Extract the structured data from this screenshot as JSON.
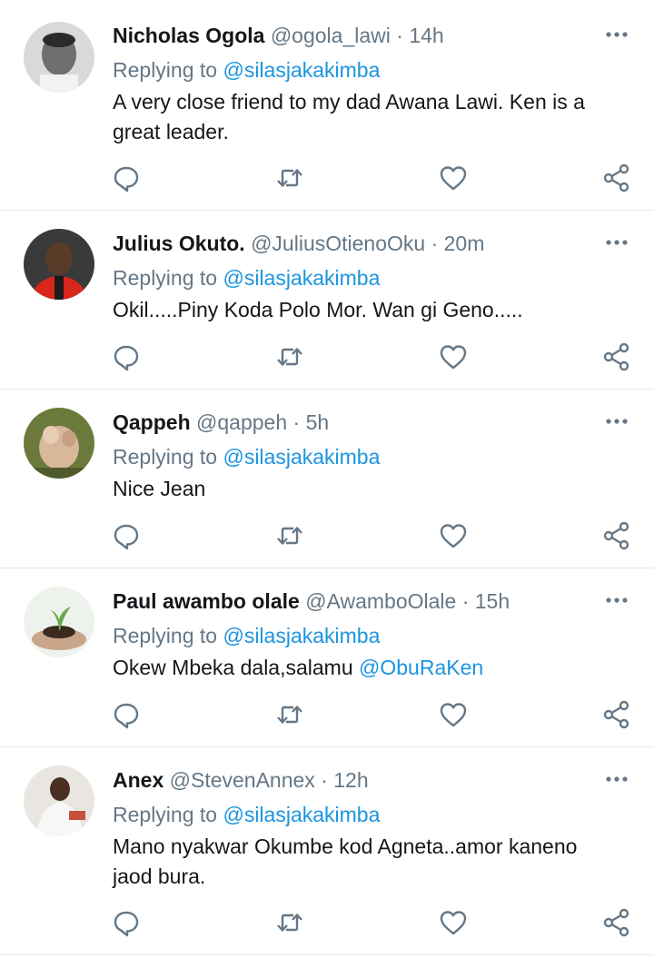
{
  "tweets": [
    {
      "name": "Nicholas Ogola",
      "handle": "@ogola_lawi",
      "time": "· 14h",
      "replying_prefix": "Replying to",
      "replying_to": "@silasjakakimba",
      "text": "A very close friend to my dad Awana Lawi. Ken is a great leader.",
      "mention": ""
    },
    {
      "name": "Julius Okuto.",
      "handle": "@JuliusOtienoOku",
      "time": "· 20m",
      "replying_prefix": "Replying to",
      "replying_to": "@silasjakakimba",
      "text": "Okil.....Piny Koda Polo Mor. Wan gi Geno.....",
      "mention": ""
    },
    {
      "name": "Qappeh",
      "handle": "@qappeh",
      "time": "· 5h",
      "replying_prefix": "Replying to",
      "replying_to": "@silasjakakimba",
      "text": "Nice Jean",
      "mention": ""
    },
    {
      "name": "Paul awambo olale",
      "handle": "@AwamboOlale",
      "time": "· 15h",
      "replying_prefix": "Replying to",
      "replying_to": "@silasjakakimba",
      "text": "Okew Mbeka dala,salamu ",
      "mention": "@ObuRaKen"
    },
    {
      "name": "Anex",
      "handle": "@StevenAnnex",
      "time": "· 12h",
      "replying_prefix": "Replying to",
      "replying_to": "@silasjakakimba",
      "text": "Mano nyakwar Okumbe kod Agneta..amor kaneno jaod bura.",
      "mention": ""
    }
  ],
  "icons": {
    "reply": "reply-icon",
    "retweet": "retweet-icon",
    "like": "heart-icon",
    "share": "share-icon",
    "more": "more-icon"
  },
  "colors": {
    "link": "#1b95e0",
    "text": "#14171a",
    "secondary": "#657786",
    "divider": "#e1e8ed"
  }
}
